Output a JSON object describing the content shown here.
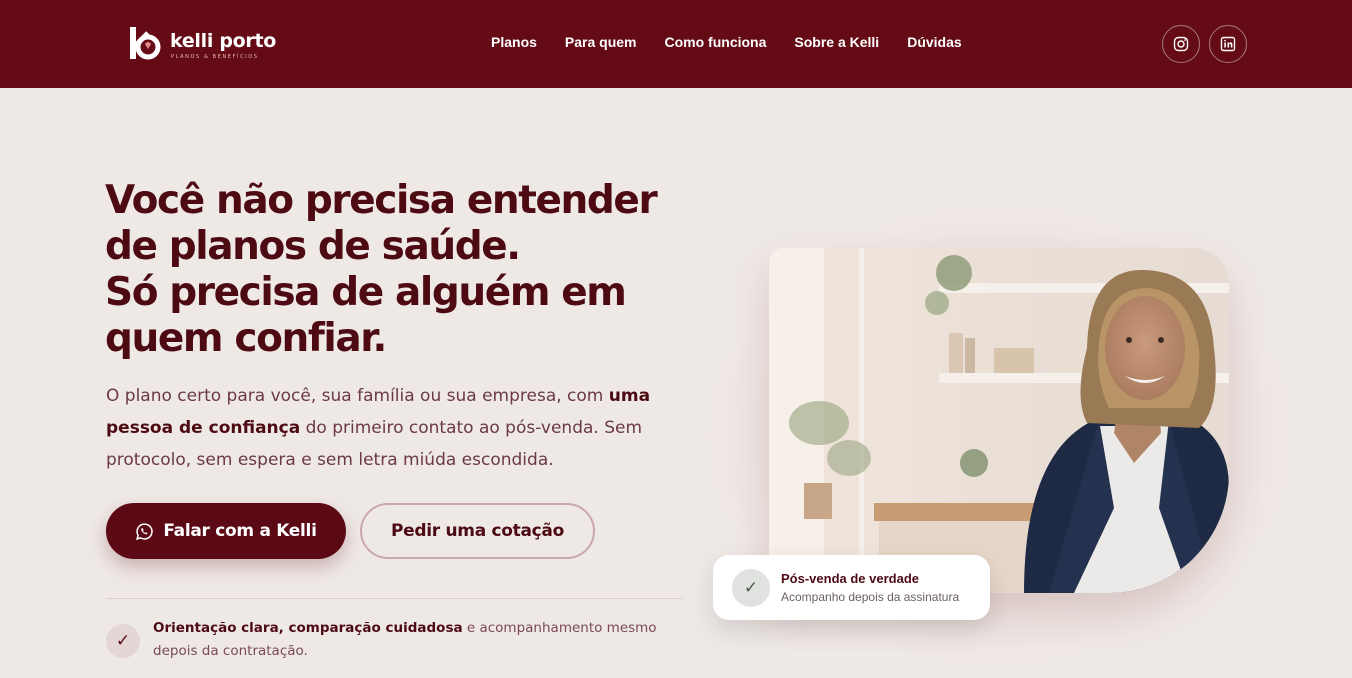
{
  "brand": {
    "name": "kelli porto",
    "tagline": "PLANOS & BENEFÍCIOS"
  },
  "nav": {
    "items": [
      {
        "label": "Planos"
      },
      {
        "label": "Para quem"
      },
      {
        "label": "Como funciona"
      },
      {
        "label": "Sobre a Kelli"
      },
      {
        "label": "Dúvidas"
      }
    ]
  },
  "social": {
    "icons": [
      "instagram-icon",
      "linkedin-icon"
    ]
  },
  "hero": {
    "headline_lines": [
      "Você não precisa entender",
      "de planos de saúde.",
      "Só precisa de alguém em",
      "quem confiar."
    ],
    "lede_intro": "O plano certo para você, sua família ou sua empresa, com ",
    "lede_bold": "uma pessoa de confiança",
    "lede_rest": " do primeiro contato ao pós-venda. Sem protocolo, sem espera e sem letra miúda escondida.",
    "primary_cta": "Falar com a Kelli",
    "secondary_cta": "Pedir uma cotação",
    "feature_bold": "Orientação clara, comparação cuidadosa",
    "feature_rest": " e acompanhamento mesmo depois da contratação."
  },
  "badge": {
    "title": "Pós-venda de verdade",
    "subtitle": "Acompanho depois da assinatura"
  },
  "colors": {
    "brand": "#640b16",
    "text_dark": "#4d0a13",
    "background": "#efe9e6"
  }
}
